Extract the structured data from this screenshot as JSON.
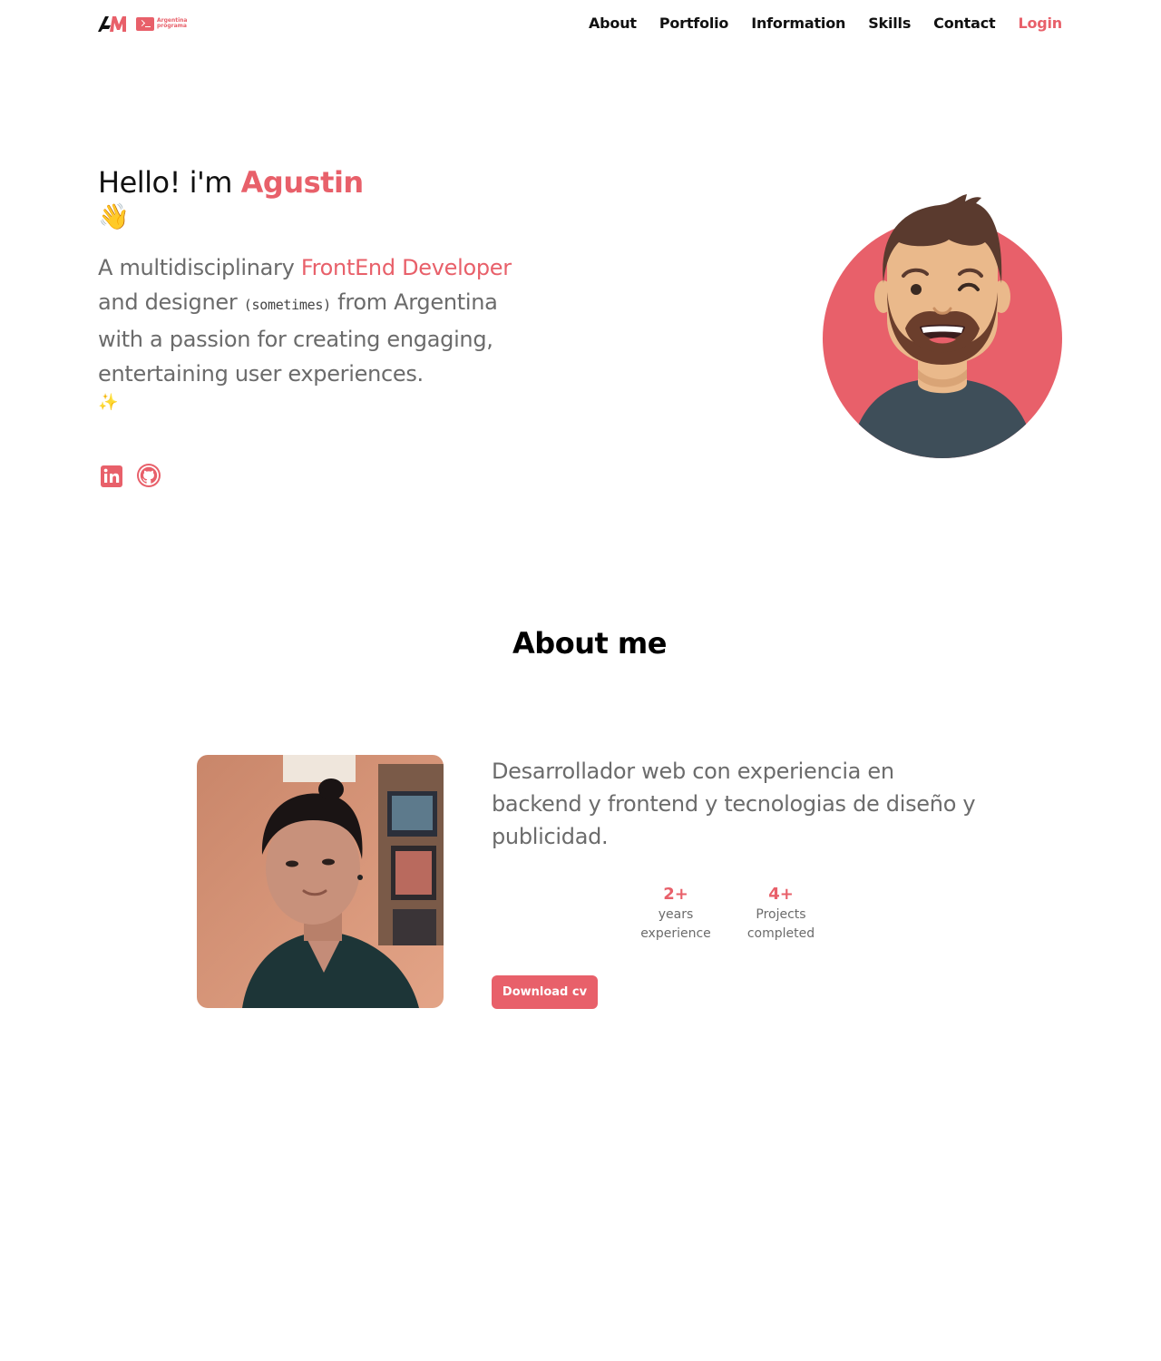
{
  "brand": {
    "logo_text": "AM",
    "badge_text_line1": "Argentina",
    "badge_text_line2": "programa"
  },
  "nav": {
    "items": [
      {
        "label": "About"
      },
      {
        "label": "Portfolio"
      },
      {
        "label": "Information"
      },
      {
        "label": "Skills"
      },
      {
        "label": "Contact"
      }
    ],
    "login_label": "Login"
  },
  "hero": {
    "greeting": "Hello! i'm",
    "name": "Agustin",
    "wave_emoji": "👋",
    "desc_part1": "A multidisciplinary",
    "desc_accent": "FrontEnd Developer",
    "desc_part2": "and designer",
    "desc_small": "(sometimes)",
    "desc_part3": "from Argentina with a passion for creating engaging, entertaining user experiences.",
    "sparkle_emoji": "✨"
  },
  "social": {
    "linkedin_icon": "linkedin-icon",
    "github_icon": "github-icon"
  },
  "about": {
    "title": "About me",
    "description": "Desarrollador web con experiencia en backend y frontend y tecnologias de diseño y publicidad.",
    "stats": [
      {
        "value": "2+",
        "label_line1": "years",
        "label_line2": "experience"
      },
      {
        "value": "4+",
        "label_line1": "Projects",
        "label_line2": "completed"
      }
    ],
    "cv_button_label": "Download cv"
  },
  "colors": {
    "accent": "#e8606a",
    "text": "#6b6b6b",
    "heading": "#111111",
    "shirt": "#3e4e59",
    "skin": "#eab98b",
    "hair": "#5a3a2e"
  }
}
